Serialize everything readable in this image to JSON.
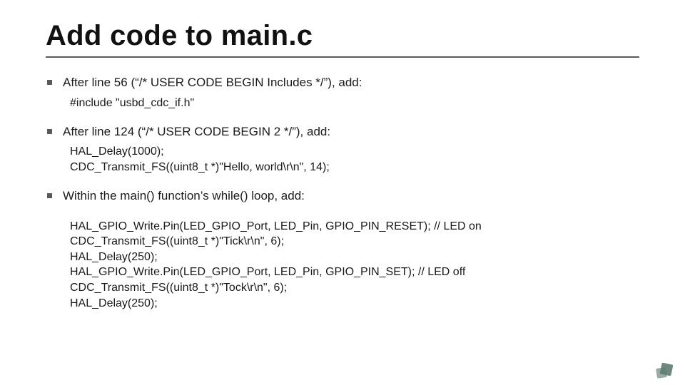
{
  "title": "Add code to main.c",
  "bullets": [
    {
      "text": "After line 56 (“/* USER CODE BEGIN Includes */”), add:",
      "code": "#include \"usbd_cdc_if.h\""
    },
    {
      "text": "After line 124 (“/* USER CODE BEGIN 2 */”), add:",
      "code": "HAL_Delay(1000);\nCDC_Transmit_FS((uint8_t *)\"Hello, world\\r\\n\", 14);"
    },
    {
      "text": "Within the main() function’s while() loop, add:",
      "code": "HAL_GPIO_Write.Pin(LED_GPIO_Port, LED_Pin, GPIO_PIN_RESET); // LED on\nCDC_Transmit_FS((uint8_t *)\"Tick\\r\\n\", 6);\nHAL_Delay(250);\nHAL_GPIO_Write.Pin(LED_GPIO_Port, LED_Pin, GPIO_PIN_SET); // LED off\nCDC_Transmit_FS((uint8_t *)\"Tock\\r\\n\", 6);\nHAL_Delay(250);"
    }
  ]
}
